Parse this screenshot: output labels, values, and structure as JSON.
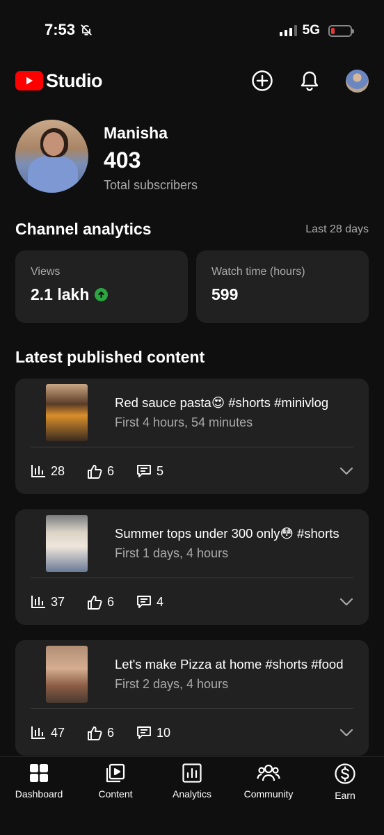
{
  "status": {
    "time": "7:53",
    "network": "5G"
  },
  "header": {
    "logo_text": "Studio"
  },
  "profile": {
    "name": "Manisha",
    "subscribers": "403",
    "subscribers_label": "Total subscribers"
  },
  "analytics": {
    "title": "Channel analytics",
    "period": "Last 28 days",
    "cards": [
      {
        "label": "Views",
        "value": "2.1 lakh",
        "trend": "up"
      },
      {
        "label": "Watch time (hours)",
        "value": "599"
      }
    ]
  },
  "latest": {
    "title": "Latest published content",
    "items": [
      {
        "title": "Red sauce pasta😍 #shorts #minivlog",
        "subtitle": "First 4 hours, 54 minutes",
        "views": "28",
        "likes": "6",
        "comments": "5"
      },
      {
        "title": "Summer tops under 300 only😳 #shorts",
        "subtitle": "First 1 days, 4 hours",
        "views": "37",
        "likes": "6",
        "comments": "4"
      },
      {
        "title": "Let's make Pizza at home #shorts #food",
        "subtitle": "First 2 days, 4 hours",
        "views": "47",
        "likes": "6",
        "comments": "10"
      }
    ]
  },
  "nav": {
    "items": [
      {
        "label": "Dashboard",
        "icon": "dashboard-icon"
      },
      {
        "label": "Content",
        "icon": "content-icon"
      },
      {
        "label": "Analytics",
        "icon": "analytics-icon"
      },
      {
        "label": "Community",
        "icon": "community-icon"
      },
      {
        "label": "Earn",
        "icon": "earn-icon"
      }
    ]
  },
  "colors": {
    "background": "#0f0f0f",
    "card": "#212121",
    "brand_red": "#ff0000",
    "trend_green": "#2ba640"
  }
}
